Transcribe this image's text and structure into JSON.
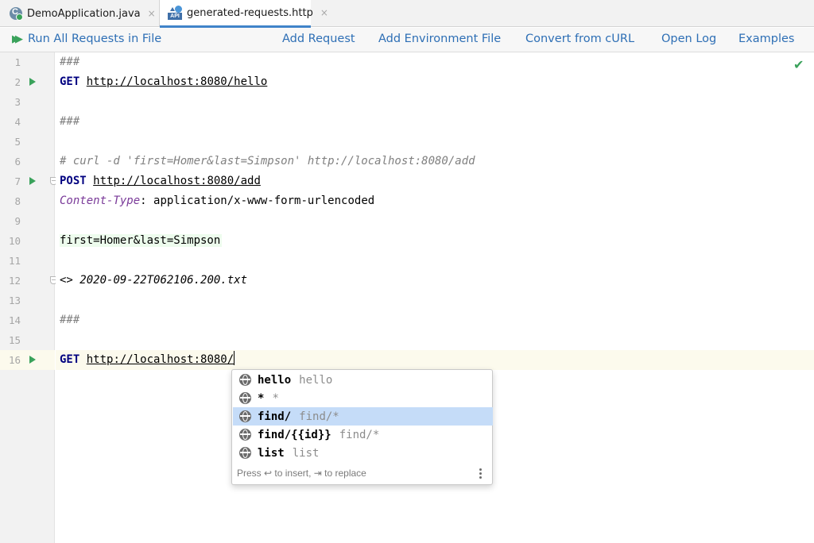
{
  "tabs": [
    {
      "label": "DemoApplication.java",
      "icon": "java-class-icon",
      "close": "×"
    },
    {
      "label": "generated-requests.http",
      "icon": "api-file-icon",
      "close": "×",
      "active": true
    }
  ],
  "toolbar": {
    "run_all": "Run All Requests in File",
    "add_request": "Add Request",
    "add_env": "Add Environment File",
    "convert_curl": "Convert from cURL",
    "open_log": "Open Log",
    "examples": "Examples"
  },
  "editor": {
    "line_numbers": [
      "1",
      "2",
      "3",
      "4",
      "5",
      "6",
      "7",
      "8",
      "9",
      "10",
      "11",
      "12",
      "13",
      "14",
      "15",
      "16"
    ],
    "lines": {
      "l1": "###",
      "l2_method": "GET",
      "l2_url": "http://localhost:8080/hello",
      "l4": "###",
      "l6": "# curl -d 'first=Homer&last=Simpson' http://localhost:8080/add",
      "l7_method": "POST",
      "l7_url": "http://localhost:8080/add",
      "l8_name": "Content-Type",
      "l8_sep": ":",
      "l8_value": " application/x-www-form-urlencoded",
      "l10": "first=Homer&last=Simpson",
      "l12_prefix": "<> ",
      "l12_file": "2020-09-22T062106.200.txt",
      "l14": "###",
      "l16_method": "GET",
      "l16_url": "http://localhost:8080/"
    },
    "status_icon": "check-icon",
    "status_color": "#3aa25b"
  },
  "completion": {
    "items": [
      {
        "main": "hello",
        "tail": "hello"
      },
      {
        "main": "*",
        "tail": "*"
      },
      {
        "main": "find/",
        "tail": "find/*",
        "selected": true
      },
      {
        "main": "find/{{id}}",
        "tail": "find/*"
      },
      {
        "main": "list",
        "tail": "list"
      }
    ],
    "footer": "Press ↩ to insert, ⇥ to replace"
  },
  "colors": {
    "accent": "#2e6fb5",
    "run_green": "#3aa25b",
    "selection": "#c5dcf8",
    "current_line": "#fcfaed"
  }
}
